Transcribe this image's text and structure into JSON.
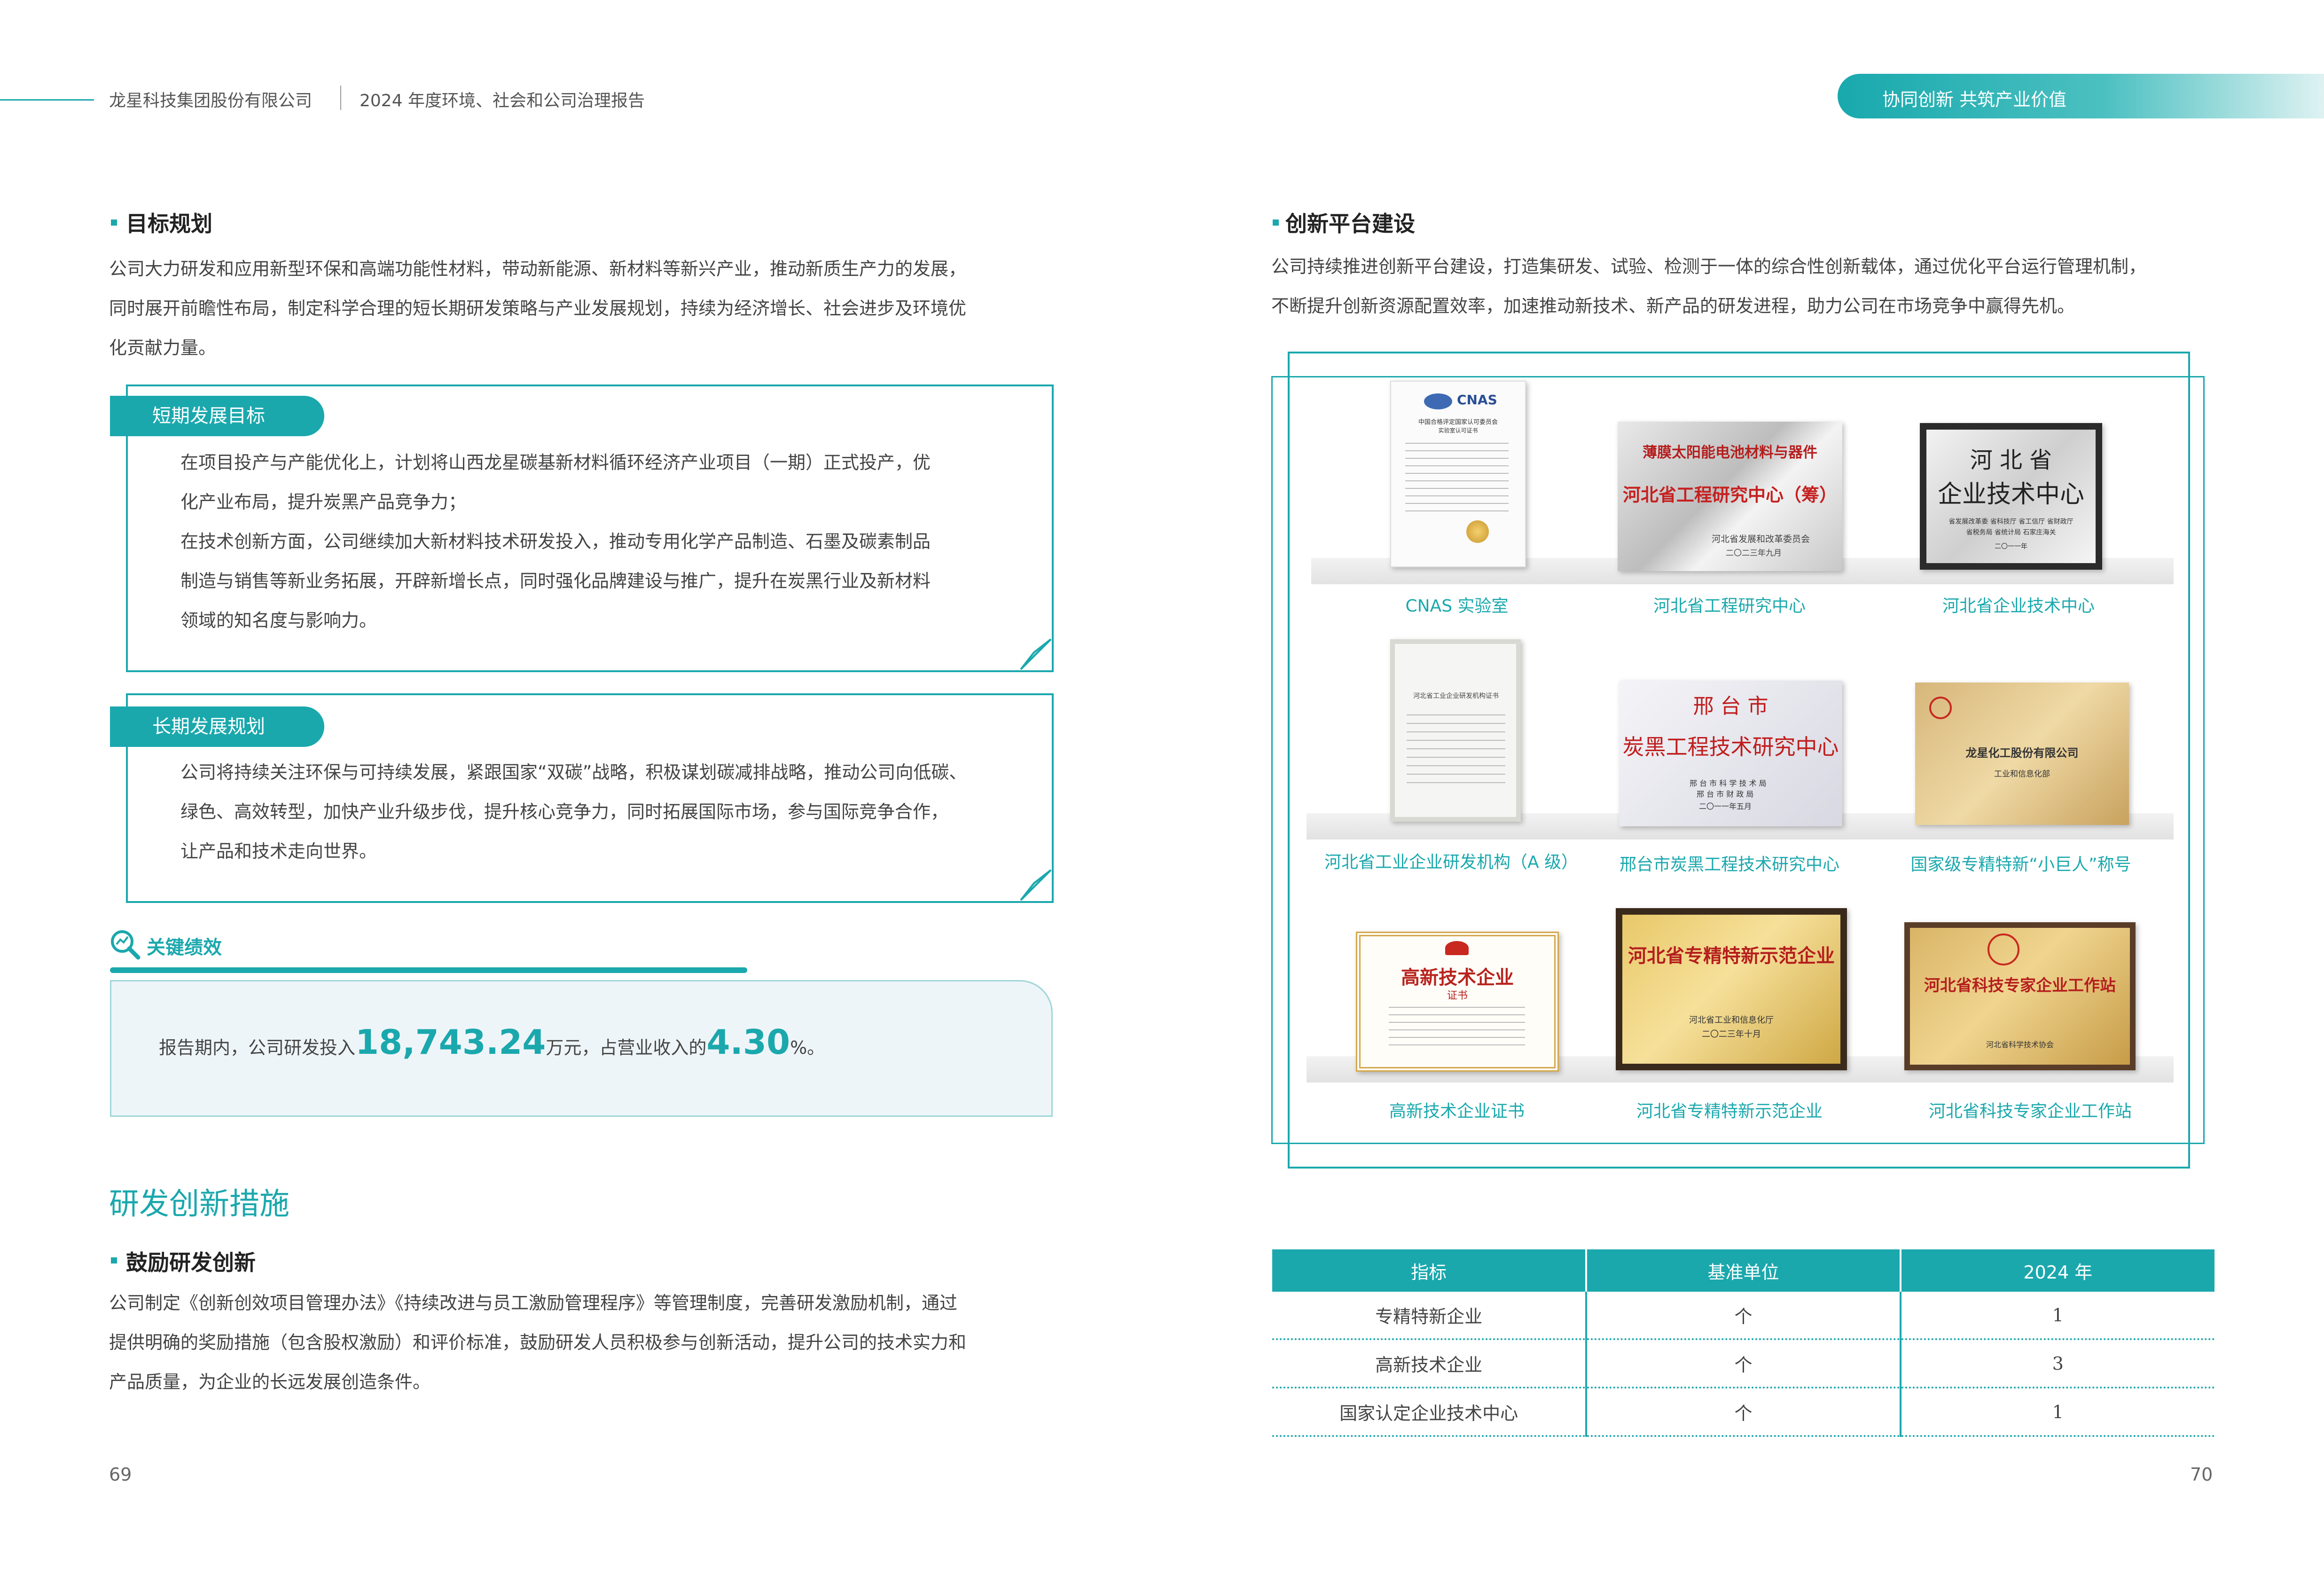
{
  "header": {
    "company": "龙星科技集团股份有限公司",
    "report": "2024 年度环境、社会和公司治理报告",
    "section_pill": "协同创新  共筑产业价值"
  },
  "left": {
    "goal_heading": "目标规划",
    "goal_para": [
      "公司大力研发和应用新型环保和高端功能性材料，带动新能源、新材料等新兴产业，推动新质生产力的发展，",
      "同时展开前瞻性布局，制定科学合理的短长期研发策略与产业发展规划，持续为经济增长、社会进步及环境优",
      "化贡献力量。"
    ],
    "short_term": {
      "tab": "短期发展目标",
      "lines": [
        "在项目投产与产能优化上，计划将山西龙星碳基新材料循环经济产业项目（一期）正式投产，优",
        "化产业布局，提升炭黑产品竞争力；",
        "在技术创新方面，公司继续加大新材料技术研发投入，推动专用化学产品制造、石墨及碳素制品",
        "制造与销售等新业务拓展，开辟新增长点，同时强化品牌建设与推广，提升在炭黑行业及新材料",
        "领域的知名度与影响力。"
      ]
    },
    "long_term": {
      "tab": "长期发展规划",
      "lines": [
        "公司将持续关注环保与可持续发展，紧跟国家“双碳”战略，积极谋划碳减排战略，推动公司向低碳、",
        "绿色、高效转型，加快产业升级步伐，提升核心竞争力，同时拓展国际市场，参与国际竞争合作，",
        "让产品和技术走向世界。"
      ]
    },
    "kpi": {
      "title": "关键绩效",
      "prefix": "报告期内，公司研发投入",
      "amount": "18,743.24",
      "mid": "万元，占营业收入的",
      "ratio": "4.30",
      "suffix": "%。"
    },
    "rd_heading": "研发创新措施",
    "incentive_heading": "鼓励研发创新",
    "incentive_para": [
      "公司制定《创新创效项目管理办法》《持续改进与员工激励管理程序》等管理制度，完善研发激励机制，通过",
      "提供明确的奖励措施（包含股权激励）和评价标准，鼓励研发人员积极参与创新活动，提升公司的技术实力和",
      "产品质量，为企业的长远发展创造条件。"
    ],
    "page_number": "69"
  },
  "right": {
    "platform_heading": "创新平台建设",
    "platform_para": [
      "公司持续推进创新平台建设，打造集研发、试验、检测于一体的综合性创新载体，通过优化平台运行管理机制，",
      "不断提升创新资源配置效率，加速推动新技术、新产品的研发进程，助力公司在市场竞争中赢得先机。"
    ],
    "certificates": [
      {
        "caption": "CNAS 实验室",
        "logo": "CNAS",
        "lines": [
          "中国合格评定国家认可委员会",
          "实验室认可证书"
        ]
      },
      {
        "caption": "河北省工程研究中心",
        "lines": [
          "薄膜太阳能电池材料与器件",
          "河北省工程研究中心（筹）",
          "河北省发展和改革委员会",
          "二〇二三年九月"
        ]
      },
      {
        "caption": "河北省企业技术中心",
        "lines": [
          "河 北 省",
          "企业技术中心",
          "省发展改革委 省科技厅 省工信厅 省财政厅",
          "省税务局 省统计局 石家庄海关",
          "二〇一一年"
        ]
      },
      {
        "caption": "河北省工业企业研发机构（A 级）",
        "lines": [
          "河北省工业企业研发机构证书"
        ]
      },
      {
        "caption": "邢台市炭黑工程技术研究中心",
        "lines": [
          "邢 台 市",
          "炭黑工程技术研究中心",
          "邢 台 市 科 学 技 术 局",
          "邢 台 市 财 政 局",
          "二〇一一年五月"
        ]
      },
      {
        "caption": "国家级专精特新“小巨人”称号",
        "lines": [
          "龙星化工股份有限公司",
          "工业和信息化部"
        ]
      },
      {
        "caption": "高新技术企业证书",
        "lines": [
          "高新技术企业",
          "证书"
        ]
      },
      {
        "caption": "河北省专精特新示范企业",
        "lines": [
          "河北省专精特新示范企业",
          "河北省工业和信息化厅",
          "二〇二三年十月"
        ]
      },
      {
        "caption": "河北省科技专家企业工作站",
        "lines": [
          "河北省科技专家企业工作站",
          "河北省科学技术协会"
        ]
      }
    ],
    "table": {
      "headers": [
        "指标",
        "基准单位",
        "2024 年"
      ],
      "rows": [
        [
          "专精特新企业",
          "个",
          "1"
        ],
        [
          "高新技术企业",
          "个",
          "3"
        ],
        [
          "国家认定企业技术中心",
          "个",
          "1"
        ]
      ]
    },
    "page_number": "70"
  },
  "colors": {
    "accent": "#1aa8ad",
    "text": "#444444",
    "kpi_bg": "#eef5f9"
  }
}
